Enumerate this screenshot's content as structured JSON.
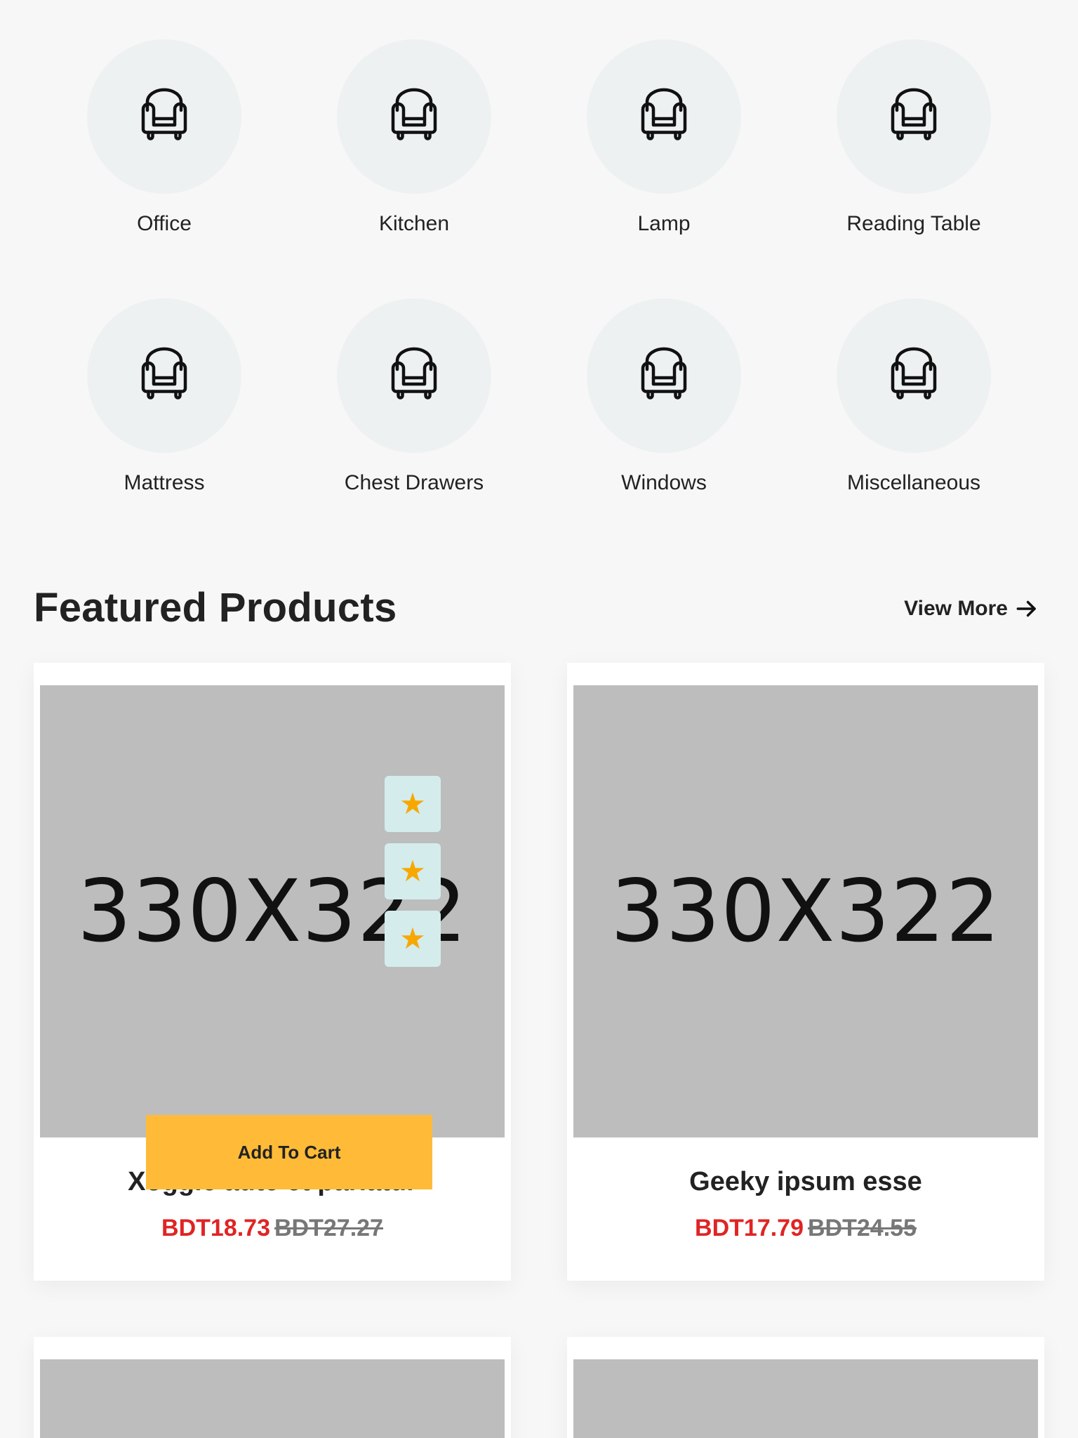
{
  "categories": [
    {
      "label": "Office",
      "icon": "armchair-icon"
    },
    {
      "label": "Kitchen",
      "icon": "armchair-icon"
    },
    {
      "label": "Lamp",
      "icon": "armchair-icon"
    },
    {
      "label": "Reading Table",
      "icon": "armchair-icon"
    },
    {
      "label": "Mattress",
      "icon": "armchair-icon"
    },
    {
      "label": "Chest Drawers",
      "icon": "armchair-icon"
    },
    {
      "label": "Windows",
      "icon": "armchair-icon"
    },
    {
      "label": "Miscellaneous",
      "icon": "armchair-icon"
    }
  ],
  "featured": {
    "title": "Featured Products",
    "view_more_label": "View More"
  },
  "products": [
    {
      "image_text": "330X322",
      "name": "Xoggle aute et pariatur",
      "price": "BDT18.73",
      "old_price": "BDT27.27",
      "add_to_cart_label": "Add To Cart",
      "action_icon": "star-icon"
    },
    {
      "image_text": "330X322",
      "name": "Geeky ipsum esse",
      "price": "BDT17.79",
      "old_price": "BDT24.55"
    }
  ],
  "colors": {
    "accent": "#ffbb38",
    "sale_price": "#e02424",
    "old_price": "#777777",
    "star": "#f7a800",
    "circle_bg": "#eef1f2",
    "placeholder_bg": "#bdbdbd"
  }
}
